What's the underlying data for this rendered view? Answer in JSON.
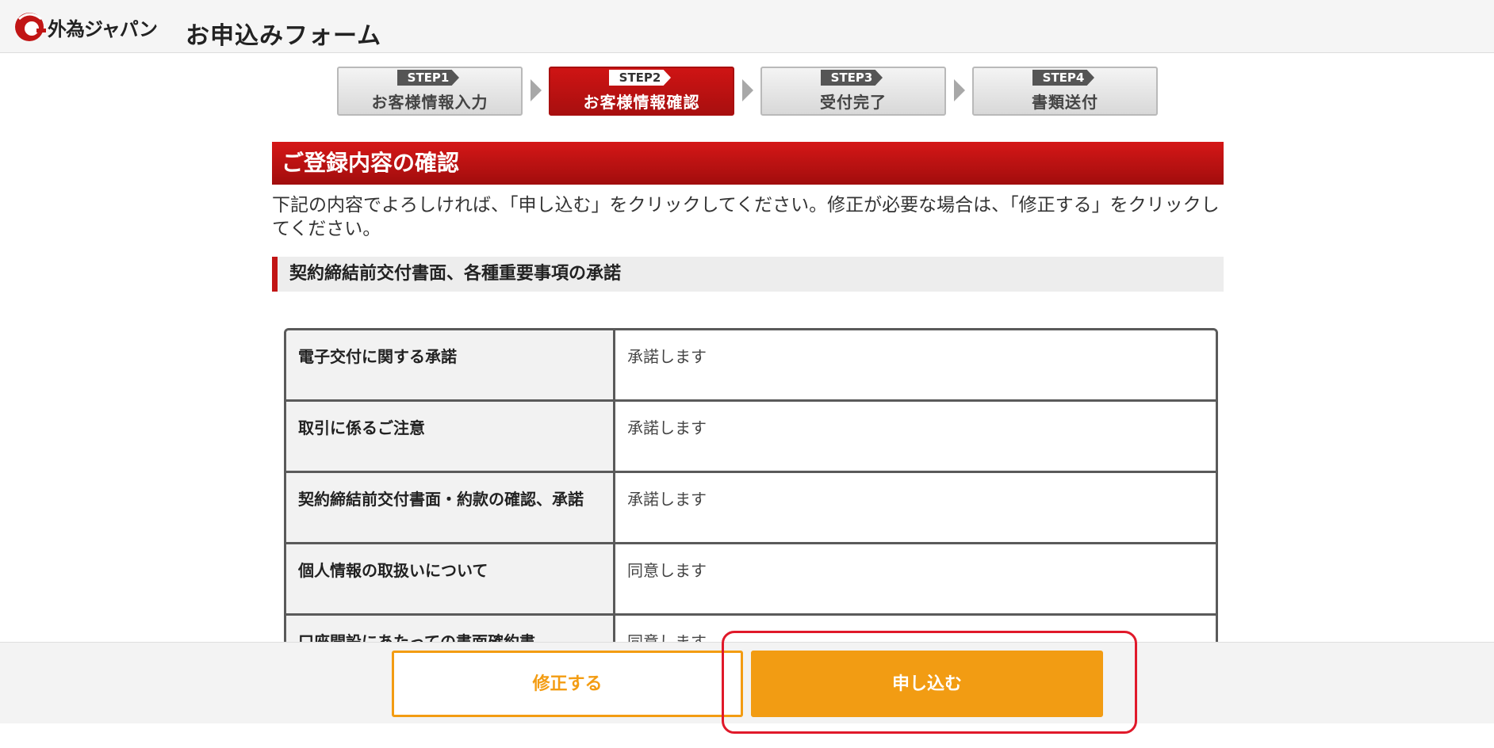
{
  "header": {
    "logo_text": "外為ジャパン",
    "form_title": "お申込みフォーム"
  },
  "steps": [
    {
      "tag": "STEP1",
      "label": "お客様情報入力",
      "active": false
    },
    {
      "tag": "STEP2",
      "label": "お客様情報確認",
      "active": true
    },
    {
      "tag": "STEP3",
      "label": "受付完了",
      "active": false
    },
    {
      "tag": "STEP4",
      "label": "書類送付",
      "active": false
    }
  ],
  "section": {
    "title": "ご登録内容の確認",
    "instructions": "下記の内容でよろしければ、「申し込む」をクリックしてください。修正が必要な場合は、「修正する」をクリックしてください。",
    "subsection_title": "契約締結前交付書面、各種重要事項の承諾"
  },
  "table": {
    "rows": [
      {
        "label": "電子交付に関する承諾",
        "value": "承諾します"
      },
      {
        "label": "取引に係るご注意",
        "value": "承諾します"
      },
      {
        "label": "契約締結前交付書面・約款の確認、承諾",
        "value": "承諾します"
      },
      {
        "label": "個人情報の取扱いについて",
        "value": "同意します"
      },
      {
        "label": "口座開設にあたっての書面確約書",
        "value": "同意します"
      }
    ]
  },
  "actions": {
    "modify_label": "修正する",
    "apply_label": "申し込む"
  },
  "colors": {
    "brand_red": "#c11515",
    "action_orange": "#f29c13",
    "highlight_red": "#e0192a"
  }
}
